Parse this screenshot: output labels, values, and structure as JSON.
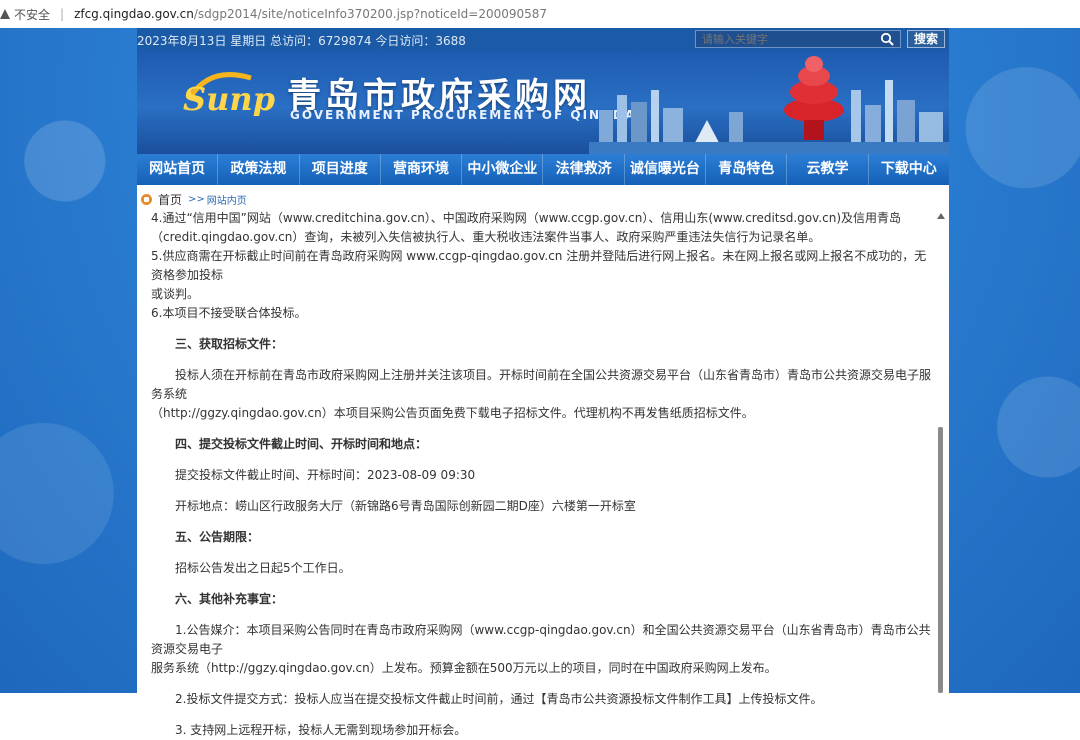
{
  "browser": {
    "security_label": "不安全",
    "url_host": "zfcg.qingdao.gov.cn",
    "url_path": "/sdgp2014/site/noticeInfo370200.jsp?noticeId=200090587"
  },
  "topbar": {
    "stats": "2023年8月13日 星期日 总访问：6729874 今日访问：3688",
    "search_placeholder": "请输入关键字",
    "search_button": "搜索"
  },
  "banner": {
    "logo_text": "Sunp",
    "title_cn": "青岛市政府采购网",
    "title_en": "GOVERNMENT PROCUREMENT OF QINGDAO"
  },
  "nav": {
    "items": [
      "网站首页",
      "政策法规",
      "项目进度",
      "营商环境",
      "中小微企业",
      "法律救济",
      "诚信曝光台",
      "青岛特色",
      "云教学",
      "下载中心"
    ]
  },
  "breadcrumb": {
    "home": "首页",
    "sep": ">>",
    "current": "网站内页"
  },
  "article": {
    "l1": "4.通过“信用中国”网站（www.creditchina.gov.cn）、中国政府采购网（www.ccgp.gov.cn）、信用山东(www.creditsd.gov.cn)及信用青岛",
    "l2": "（credit.qingdao.gov.cn）查询，未被列入失信被执行人、重大税收违法案件当事人、政府采购严重违法失信行为记录名单。",
    "l3": "5.供应商需在开标截止时间前在青岛政府采购网 www.ccgp-qingdao.gov.cn 注册并登陆后进行网上报名。未在网上报名或网上报名不成功的，无资格参加投标",
    "l4": "或谈判。",
    "l5": "6.本项目不接受联合体投标。",
    "s3": "三、获取招标文件：",
    "p3a": "投标人须在开标前在青岛市政府采购网上注册并关注该项目。开标时间前在全国公共资源交易平台（山东省青岛市）青岛市公共资源交易电子服务系统",
    "p3b": "（http://ggzy.qingdao.gov.cn）本项目采购公告页面免费下载电子招标文件。代理机构不再发售纸质招标文件。",
    "s4": "四、提交投标文件截止时间、开标时间和地点：",
    "p4a": "提交投标文件截止时间、开标时间：2023-08-09 09:30",
    "p4b": "开标地点：崂山区行政服务大厅（新锦路6号青岛国际创新园二期D座）六楼第一开标室",
    "s5": "五、公告期限：",
    "p5": "招标公告发出之日起5个工作日。",
    "s6": "六、其他补充事宜：",
    "p6a": "1.公告媒介：本项目采购公告同时在青岛市政府采购网（www.ccgp-qingdao.gov.cn）和全国公共资源交易平台（山东省青岛市）青岛市公共资源交易电子",
    "p6b": "服务系统（http://ggzy.qingdao.gov.cn）上发布。预算金额在500万元以上的项目，同时在中国政府采购网上发布。",
    "p6c": "2.投标文件提交方式：投标人应当在提交投标文件截止时间前，通过【青岛市公共资源投标文件制作工具】上传投标文件。",
    "p6d": "3. 支持网上远程开标，投标人无需到现场参加开标会。"
  },
  "colors": {
    "page_bg": "#2b7fd4",
    "nav_bg": "#1560b8",
    "accent_orange": "#e98b2a"
  }
}
